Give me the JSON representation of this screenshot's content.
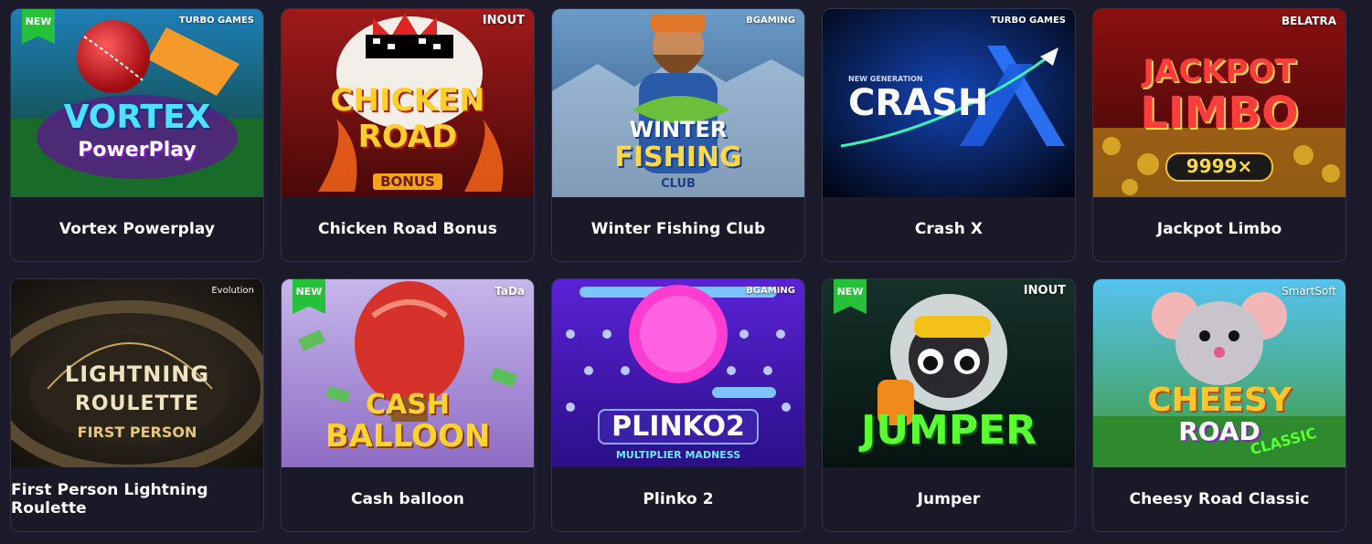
{
  "games": [
    {
      "title": "Vortex Powerplay",
      "is_new": true,
      "provider": "TURBO GAMES",
      "logo_line1": "VORTEX",
      "logo_line2": "PowerPlay",
      "bg_top": "#1f7fb8",
      "bg_bottom": "#0d3a1e"
    },
    {
      "title": "Chicken Road Bonus",
      "is_new": false,
      "provider": "INOUT",
      "logo_line1": "CHICKEN",
      "logo_line2": "ROAD",
      "logo_extra": "BONUS",
      "bg_top": "#a01a1a",
      "bg_bottom": "#4a0808"
    },
    {
      "title": "Winter Fishing Club",
      "is_new": false,
      "provider": "BGAMING",
      "logo_line1": "WINTER",
      "logo_line2": "FISHING",
      "logo_extra": "CLUB",
      "bg_top": "#6d9cc9",
      "bg_bottom": "#2a4d78"
    },
    {
      "title": "Crash X",
      "is_new": false,
      "provider": "TURBO GAMES",
      "logo_line1": "NEW GENERATION",
      "logo_line2": "CRASH",
      "bg_top": "#0a1f59",
      "bg_bottom": "#020716"
    },
    {
      "title": "Jackpot Limbo",
      "is_new": false,
      "provider": "BELATRA",
      "logo_line1": "JACKPOT",
      "logo_line2": "LIMBO",
      "logo_extra": "9999×",
      "bg_top": "#8a1010",
      "bg_bottom": "#3b0606"
    },
    {
      "title": "First Person Lightning Roulette",
      "is_new": false,
      "provider": "Evolution",
      "logo_line1": "LIGHTNING",
      "logo_line2": "ROULETTE",
      "logo_extra": "FIRST PERSON",
      "bg_top": "#3a3328",
      "bg_bottom": "#14110c"
    },
    {
      "title": "Cash balloon",
      "is_new": true,
      "provider": "TaDa",
      "logo_line1": "CASH",
      "logo_line2": "BALLOON",
      "bg_top": "#c6b6ea",
      "bg_bottom": "#8d6cc4"
    },
    {
      "title": "Plinko 2",
      "is_new": false,
      "provider": "BGAMING",
      "logo_line1": "PLINKO2",
      "logo_line2": "MULTIPLIER MADNESS",
      "bg_top": "#5a22d6",
      "bg_bottom": "#2a0f86"
    },
    {
      "title": "Jumper",
      "is_new": true,
      "provider": "INOUT",
      "logo_line1": "JUMPER",
      "bg_top": "#16302a",
      "bg_bottom": "#061410"
    },
    {
      "title": "Cheesy Road Classic",
      "is_new": false,
      "provider": "SmartSoft",
      "logo_line1": "CHEESY",
      "logo_line2": "ROAD",
      "logo_extra": "CLASSIC",
      "bg_top": "#56c3f0",
      "bg_bottom": "#3f9a3a"
    }
  ],
  "new_label": "NEW"
}
